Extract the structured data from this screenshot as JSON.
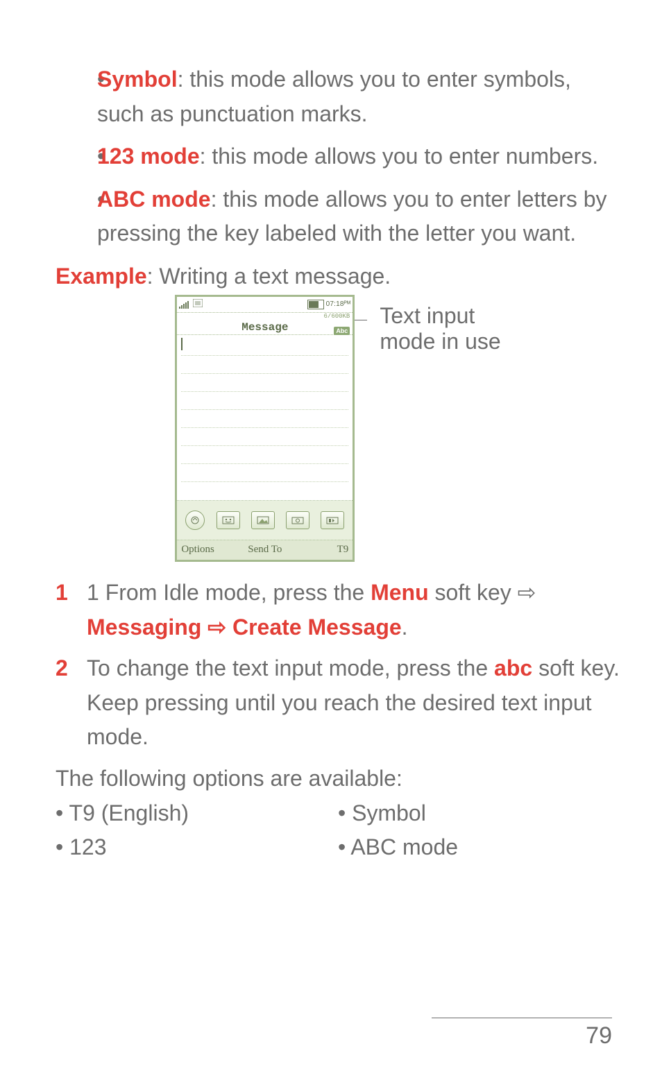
{
  "bullets": [
    {
      "term": "Symbol",
      "rest": ": this mode allows you to enter symbols, such as punctuation marks."
    },
    {
      "term": "123 mode",
      "rest": ": this mode allows you to enter numbers."
    },
    {
      "term": "ABC mode",
      "rest": ": this mode allows you to enter letters by pressing the key labeled with the letter you want."
    }
  ],
  "example_label": "Example",
  "example_rest": ": Writing a text message.",
  "phone": {
    "status_time": "07:18ᴾᴹ",
    "title": "Message",
    "char_count": "6/600KB",
    "mode_badge": "Abc",
    "bottom_left": "Options",
    "bottom_center": "Send To",
    "bottom_right": "T9"
  },
  "caption_l1": "Text input",
  "caption_l2": "mode in use",
  "step1": {
    "num": "1",
    "prefix": "1 From Idle mode, press the ",
    "menu": "Menu",
    "after_menu": " soft key ",
    "arrow": "⇨",
    "messaging": "Messaging",
    "arrow2": " ⇨ ",
    "create": "Create Message",
    "period": "."
  },
  "step2": {
    "num": "2",
    "line1_prefix": "To change the text input mode, press the ",
    "abc": "abc",
    "line1_suffix": " soft key.",
    "line2": "Keep pressing until you reach the desired text input mode."
  },
  "options_intro": "The following options are available:",
  "opts_col1": [
    "• T9 (English)",
    "• 123"
  ],
  "opts_col2": [
    "• Symbol",
    "• ABC mode"
  ],
  "page_number": "79"
}
